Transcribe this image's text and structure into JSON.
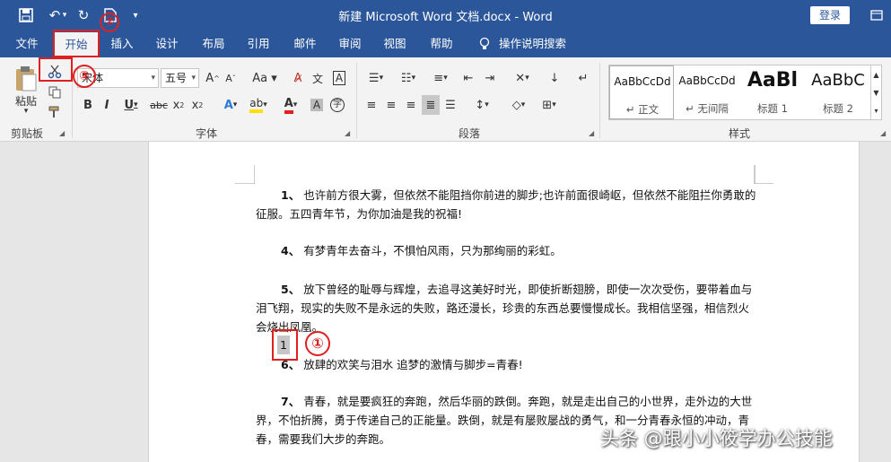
{
  "titlebar": {
    "title": "新建 Microsoft Word 文档.docx  -  Word",
    "login": "登录"
  },
  "tabs": [
    {
      "label": "文件"
    },
    {
      "label": "开始"
    },
    {
      "label": "插入"
    },
    {
      "label": "设计"
    },
    {
      "label": "布局"
    },
    {
      "label": "引用"
    },
    {
      "label": "邮件"
    },
    {
      "label": "审阅"
    },
    {
      "label": "视图"
    },
    {
      "label": "帮助"
    },
    {
      "label": "操作说明搜索"
    }
  ],
  "ribbon": {
    "clipboard": {
      "paste": "粘贴",
      "label": "剪贴板"
    },
    "font": {
      "name": "宋体",
      "size": "五号",
      "label": "字体"
    },
    "paragraph": {
      "label": "段落"
    },
    "styles": {
      "label": "样式",
      "items": [
        {
          "preview": "AaBbCcDd",
          "name": "↵ 正文"
        },
        {
          "preview": "AaBbCcDd",
          "name": "↵ 无间隔"
        },
        {
          "preview": "AaBl",
          "name": "标题 1"
        },
        {
          "preview": "AaBbC",
          "name": "标题 2"
        }
      ]
    }
  },
  "document": {
    "paragraphs": [
      {
        "num": "1、",
        "text": "也许前方很大雾，但依然不能阻挡你前进的脚步;也许前面很崎岖，但依然不能阻拦你勇敢的征服。五四青年节，为你加油是我的祝福!"
      },
      {
        "num": "4、",
        "text": "有梦青年去奋斗，不惧怕风雨，只为那绚丽的彩虹。"
      },
      {
        "num": "5、",
        "text": "放下曾经的耻辱与辉煌，去追寻这美好时光，即使折断翅膀，即使一次次受伤，要带着血与泪飞翔，现实的失败不是永远的失败，路还漫长，珍贵的东西总要慢慢成长。我相信坚强，相信烈火会烧出凤凰。"
      },
      {
        "num": "1",
        "text": ""
      },
      {
        "num": "6、",
        "text": "放肆的欢笑与泪水 追梦的激情与脚步=青春!"
      },
      {
        "num": "7、",
        "text": "青春，就是要疯狂的奔跑，然后华丽的跌倒。奔跑，就是走出自己的小世界，走外边的大世界，不怕折腾，勇于传递自己的正能量。跌倒，就是有屡败屡战的勇气，和一分青春永恒的冲动，青春，需要我们大步的奔跑。"
      }
    ]
  },
  "annotations": {
    "one": "①",
    "two": "②",
    "three": "③"
  },
  "watermark": "头条 @跟小小筱学办公技能",
  "colors": {
    "brand": "#2b579a",
    "annotation": "#e02020"
  }
}
